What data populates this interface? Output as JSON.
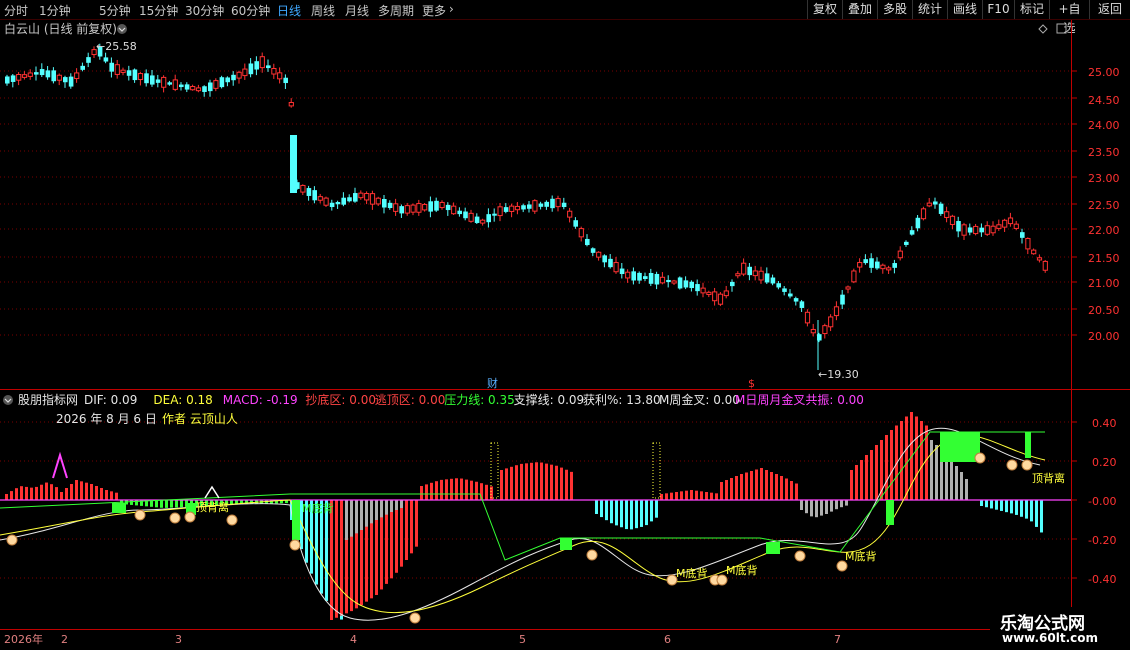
{
  "toolbar": {
    "periods": [
      "分时",
      "1分钟",
      "5分钟",
      "15分钟",
      "30分钟",
      "60分钟",
      "日线",
      "周线",
      "月线",
      "多周期",
      "更多"
    ],
    "active_index": 6,
    "more_arrow": "›",
    "right_buttons": [
      "复权",
      "叠加",
      "多股",
      "统计",
      "画线",
      "F10",
      "标记",
      "+自选",
      "返回"
    ]
  },
  "price_panel": {
    "title": "白云山 (日线 前复权)",
    "high_mark": "25.58",
    "low_mark": "19.30",
    "event_markers": [
      "财",
      "$"
    ],
    "y_ticks": [
      "25.00",
      "24.50",
      "24.00",
      "23.50",
      "23.00",
      "22.50",
      "22.00",
      "21.50",
      "21.00",
      "20.50",
      "20.00"
    ]
  },
  "indicator_panel": {
    "name": "股朋指标网",
    "fields": [
      {
        "label": "DIF: 0.09",
        "color": "#e6e6e6"
      },
      {
        "label": "DEA: 0.18",
        "color": "#ffff3c"
      },
      {
        "label": "MACD: -0.19",
        "color": "#ff44ff"
      },
      {
        "label": "抄底区: 0.00",
        "color": "#ff4444"
      },
      {
        "label": "逃顶区: 0.00",
        "color": "#ff4444"
      },
      {
        "label": "压力线: 0.35",
        "color": "#33ff33"
      },
      {
        "label": "支撑线: 0.09",
        "color": "#e6e6e6"
      },
      {
        "label": "获利%: 13.80",
        "color": "#e6e6e6"
      },
      {
        "label": "M周金叉: 0.00",
        "color": "#e6e6e6"
      },
      {
        "label": "M日周月金叉共振: 0.00",
        "color": "#ff44ff"
      }
    ],
    "date_text": "2026 年 8 月 6 日",
    "author_text": "作者 云顶山人",
    "y_ticks": [
      "0.40",
      "0.20",
      "-0.00",
      "-0.20",
      "-0.40"
    ],
    "labels": {
      "top_divergence": "顶背离",
      "top_divergence_2": "顶背离",
      "bottom_divergence_1": "M底背",
      "bottom_divergence_2": "M底背",
      "bottom_divergence_3": "M底背",
      "bottom_divergence_4": "M底背"
    }
  },
  "x_axis": {
    "year": "2026年",
    "months": [
      "2",
      "3",
      "4",
      "5",
      "6",
      "7"
    ]
  },
  "watermark": {
    "line1": "乐淘公式网",
    "line2": "www.60lt.com"
  },
  "colors": {
    "up": "#ff3232",
    "down": "#54ffff",
    "grid": "#7a0000",
    "axis": "#c00000",
    "active_tab": "#3fa8ff"
  }
}
